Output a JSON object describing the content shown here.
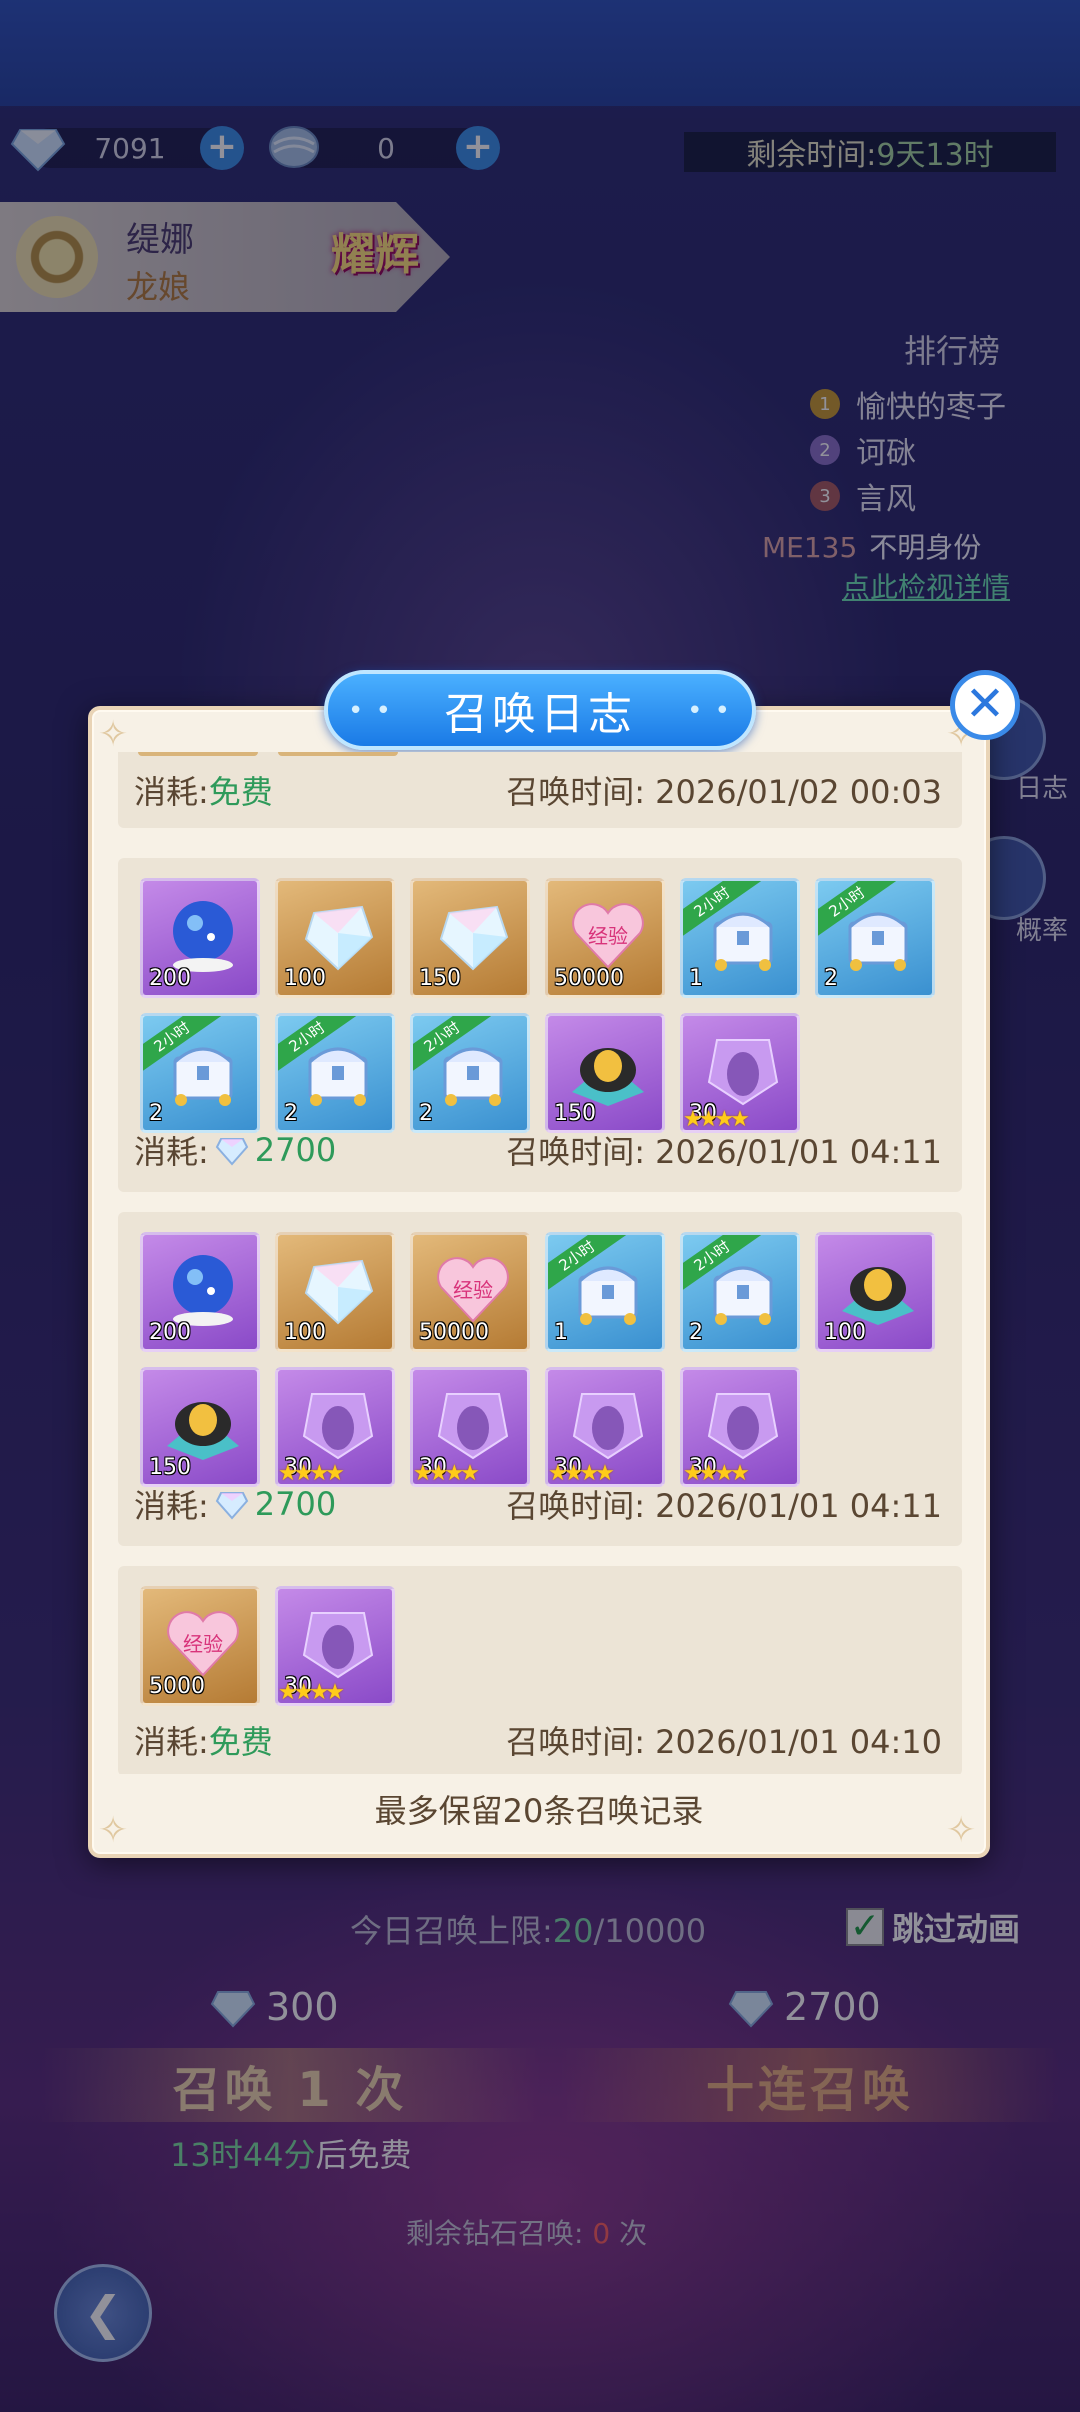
{
  "resources": [
    {
      "icon": "diamond-icon",
      "value": "7091"
    },
    {
      "icon": "scale-orb-icon",
      "value": "0"
    }
  ],
  "timer": {
    "label": "剩余时间:",
    "value": "9天13时"
  },
  "character": {
    "name": "缇娜",
    "title": "龙娘",
    "badge": "耀辉"
  },
  "ranking": {
    "title": "排行榜",
    "entries": [
      {
        "rank": "1",
        "name": "愉快的枣子"
      },
      {
        "rank": "2",
        "name": "诃砯"
      },
      {
        "rank": "3",
        "name": "言风"
      }
    ],
    "me_label": "ME135",
    "me_name": "不明身份",
    "link": "点此检视详情"
  },
  "side_buttons": [
    {
      "label": "日志"
    },
    {
      "label": "概率"
    }
  ],
  "dialog": {
    "title": "召唤日志",
    "footer": "最多保留20条召唤记录",
    "cost_label": "消耗:",
    "time_label": "召唤时间:",
    "records": [
      {
        "cost": "免费",
        "cost_type": "free",
        "time": "2026/01/02 00:03",
        "items": []
      },
      {
        "cost": "2700",
        "cost_type": "diamond",
        "time": "2026/01/01 04:11",
        "items": [
          {
            "type": "crystal-ball",
            "bg": "purple",
            "qty": "200"
          },
          {
            "type": "gem",
            "bg": "gold",
            "qty": "100"
          },
          {
            "type": "gem",
            "bg": "gold",
            "qty": "150"
          },
          {
            "type": "exp-heart",
            "bg": "gold",
            "qty": "50000"
          },
          {
            "type": "treasure-chest",
            "bg": "blue",
            "qty": "1",
            "tag": "2小时"
          },
          {
            "type": "treasure-chest",
            "bg": "blue",
            "qty": "2",
            "tag": "2小时"
          },
          {
            "type": "treasure-chest",
            "bg": "blue",
            "qty": "2",
            "tag": "2小时"
          },
          {
            "type": "treasure-chest",
            "bg": "blue",
            "qty": "2",
            "tag": "2小时"
          },
          {
            "type": "treasure-chest",
            "bg": "blue",
            "qty": "2",
            "tag": "2小时"
          },
          {
            "type": "golden-egg",
            "bg": "purple",
            "qty": "150"
          },
          {
            "type": "shard",
            "bg": "purple",
            "qty": "30",
            "stars": "★★★★"
          }
        ]
      },
      {
        "cost": "2700",
        "cost_type": "diamond",
        "time": "2026/01/01 04:11",
        "items": [
          {
            "type": "crystal-ball",
            "bg": "purple",
            "qty": "200"
          },
          {
            "type": "gem",
            "bg": "gold",
            "qty": "100"
          },
          {
            "type": "exp-heart",
            "bg": "gold",
            "qty": "50000"
          },
          {
            "type": "treasure-chest",
            "bg": "blue",
            "qty": "1",
            "tag": "2小时"
          },
          {
            "type": "treasure-chest",
            "bg": "blue",
            "qty": "2",
            "tag": "2小时"
          },
          {
            "type": "golden-egg",
            "bg": "purple",
            "qty": "100"
          },
          {
            "type": "golden-egg",
            "bg": "purple",
            "qty": "150"
          },
          {
            "type": "shard",
            "bg": "purple",
            "qty": "30",
            "stars": "★★★★"
          },
          {
            "type": "shard",
            "bg": "purple",
            "qty": "30",
            "stars": "★★★★"
          },
          {
            "type": "shard",
            "bg": "purple",
            "qty": "30",
            "stars": "★★★★"
          },
          {
            "type": "shard",
            "bg": "purple",
            "qty": "30",
            "stars": "★★★★"
          }
        ]
      },
      {
        "cost": "免费",
        "cost_type": "free",
        "time": "2026/01/01 04:10",
        "items": [
          {
            "type": "exp-heart",
            "bg": "gold",
            "qty": "5000"
          },
          {
            "type": "shard",
            "bg": "purple",
            "qty": "30",
            "stars": "★★★★"
          }
        ]
      }
    ]
  },
  "summon": {
    "limit_label": "今日召唤上限:",
    "limit_used": "20",
    "limit_total": "/10000",
    "skip_label": "跳过动画",
    "skip_checked": true,
    "single_cost": "300",
    "ten_cost": "2700",
    "single_label": "召唤 1 次",
    "ten_label": "十连召唤",
    "free_time": "13时44分",
    "free_suffix": "后免费",
    "remain_label": "剩余钻石召唤:",
    "remain_count": "0",
    "remain_unit": "次"
  },
  "colors": {
    "accent_blue": "#1a7ae6",
    "free_green": "#2e9a5a",
    "panel_bg": "#f7f1e6",
    "record_bg": "#ece4d6"
  }
}
